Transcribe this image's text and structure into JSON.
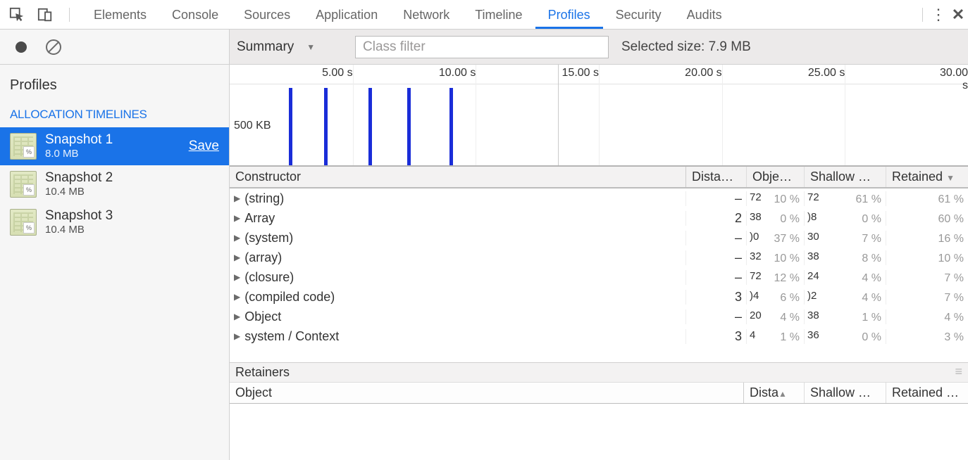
{
  "tabs": {
    "items": [
      "Elements",
      "Console",
      "Sources",
      "Application",
      "Network",
      "Timeline",
      "Profiles",
      "Security",
      "Audits"
    ],
    "active": "Profiles"
  },
  "sidebar": {
    "title": "Profiles",
    "section": "ALLOCATION TIMELINES",
    "snapshots": [
      {
        "title": "Snapshot 1",
        "size": "8.0 MB",
        "save": "Save",
        "selected": true
      },
      {
        "title": "Snapshot 2",
        "size": "10.4 MB",
        "selected": false
      },
      {
        "title": "Snapshot 3",
        "size": "10.4 MB",
        "selected": false
      }
    ]
  },
  "toolbar": {
    "mode": "Summary",
    "filter_placeholder": "Class filter",
    "selected_size_label": "Selected size: 7.9 MB"
  },
  "timeline": {
    "ticks": [
      "5.00 s",
      "10.00 s",
      "15.00 s",
      "20.00 s",
      "25.00 s",
      "30.00 s"
    ],
    "ylabel": "500 KB",
    "bars_x_pct": [
      8,
      12.8,
      18.8,
      24,
      29.8
    ]
  },
  "columns": {
    "constructor": "Constructor",
    "distance": "Distan…",
    "objects": "Objec…",
    "shallow": "Shallow …",
    "retained": "Retained"
  },
  "rows": [
    {
      "name": "(string)",
      "distance": "–",
      "obj_pct": "10 %",
      "obj_extra": "72",
      "sh_pct": "61 %",
      "sh_extra": "72",
      "rt_pct": "61 %"
    },
    {
      "name": "Array",
      "distance": "2",
      "obj_pct": "0 %",
      "obj_extra": "38",
      "sh_pct": "0 %",
      "sh_extra": ")8",
      "rt_pct": "60 %"
    },
    {
      "name": "(system)",
      "distance": "–",
      "obj_pct": "37 %",
      "obj_extra": ")0",
      "sh_pct": "7 %",
      "sh_extra": "30",
      "rt_pct": "16 %"
    },
    {
      "name": "(array)",
      "distance": "–",
      "obj_pct": "10 %",
      "obj_extra": "32",
      "sh_pct": "8 %",
      "sh_extra": "38",
      "rt_pct": "10 %"
    },
    {
      "name": "(closure)",
      "distance": "–",
      "obj_pct": "12 %",
      "obj_extra": "72",
      "sh_pct": "4 %",
      "sh_extra": "24",
      "rt_pct": "7 %"
    },
    {
      "name": "(compiled code)",
      "distance": "3",
      "obj_pct": "6 %",
      "obj_extra": ")4",
      "sh_pct": "4 %",
      "sh_extra": ")2",
      "rt_pct": "7 %"
    },
    {
      "name": "Object",
      "distance": "–",
      "obj_pct": "4 %",
      "obj_extra": "20",
      "sh_pct": "1 %",
      "sh_extra": "38",
      "rt_pct": "4 %"
    },
    {
      "name": "system / Context",
      "distance": "3",
      "obj_pct": "1 %",
      "obj_extra": "4",
      "sh_pct": "0 %",
      "sh_extra": "36",
      "rt_pct": "3 %"
    }
  ],
  "retainers": {
    "title": "Retainers",
    "cols": {
      "object": "Object",
      "distance": "Dista",
      "shallow": "Shallow …",
      "retained": "Retained …"
    }
  },
  "snap_pct_icon": "%"
}
